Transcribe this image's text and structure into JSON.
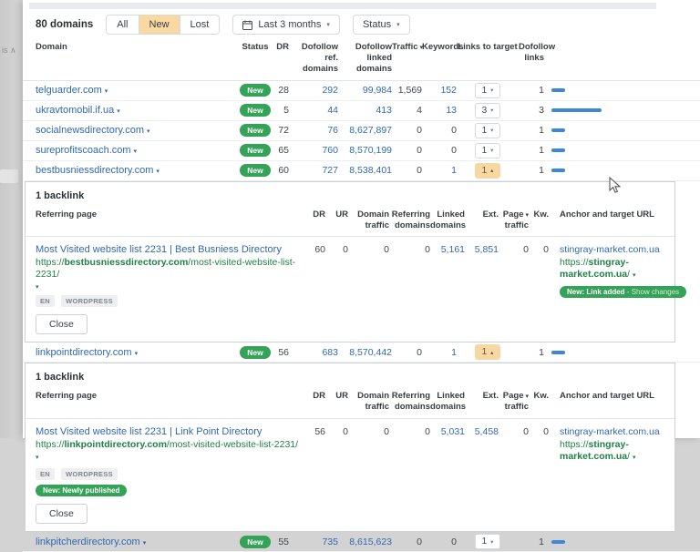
{
  "sidebar": {
    "fragment_label": "is ∧"
  },
  "toolbar": {
    "count_label": "80 domains",
    "filter_all": "All",
    "filter_new": "New",
    "filter_lost": "Lost",
    "date_range_label": "Last 3 months",
    "status_label": "Status"
  },
  "table": {
    "columns": {
      "domain": "Domain",
      "status": "Status",
      "dr": "DR",
      "dofollow_ref": [
        "Dofollow ref.",
        "domains"
      ],
      "dofollow_linked": [
        "Dofollow linked",
        "domains"
      ],
      "traffic": "Traffic",
      "keywords": "Keywords",
      "links_to_target": "Links to target",
      "dofollow_links": [
        "Dofollow",
        "links"
      ]
    },
    "rows": [
      {
        "domain": "telguarder.com",
        "status": "New",
        "dr": "28",
        "dofollow_ref": "292",
        "dofollow_linked": "99,984",
        "traffic": "1,569",
        "keywords": "152",
        "links_to_target": "1",
        "dofollow_links": "1"
      },
      {
        "domain": "ukravtomobil.if.ua",
        "status": "New",
        "dr": "5",
        "dofollow_ref": "44",
        "dofollow_linked": "413",
        "traffic": "4",
        "keywords": "13",
        "links_to_target": "3",
        "dofollow_links": "3"
      },
      {
        "domain": "socialnewsdirectory.com",
        "status": "New",
        "dr": "72",
        "dofollow_ref": "76",
        "dofollow_linked": "8,627,897",
        "traffic": "0",
        "keywords": "0",
        "links_to_target": "1",
        "dofollow_links": "1"
      },
      {
        "domain": "sureprofitscoach.com",
        "status": "New",
        "dr": "65",
        "dofollow_ref": "760",
        "dofollow_linked": "8,570,199",
        "traffic": "0",
        "keywords": "0",
        "links_to_target": "1",
        "dofollow_links": "1"
      },
      {
        "domain": "bestbusniessdirectory.com",
        "status": "New",
        "dr": "60",
        "dofollow_ref": "727",
        "dofollow_linked": "8,538,401",
        "traffic": "0",
        "keywords": "1",
        "links_to_target": "1",
        "dofollow_links": "1"
      },
      {
        "domain": "linkpointdirectory.com",
        "status": "New",
        "dr": "56",
        "dofollow_ref": "683",
        "dofollow_linked": "8,570,442",
        "traffic": "0",
        "keywords": "1",
        "links_to_target": "1",
        "dofollow_links": "1"
      },
      {
        "domain": "linkpitcherdirectory.com",
        "status": "New",
        "dr": "55",
        "dofollow_ref": "735",
        "dofollow_linked": "8,615,623",
        "traffic": "0",
        "keywords": "0",
        "links_to_target": "1",
        "dofollow_links": "1"
      }
    ]
  },
  "backlink_columns": {
    "referring_page": "Referring page",
    "dr": "DR",
    "ur": "UR",
    "domain_traffic": [
      "Domain",
      "traffic"
    ],
    "referring_domains": [
      "Referring",
      "domains"
    ],
    "linked_domains": [
      "Linked",
      "domains"
    ],
    "ext": "Ext.",
    "page_traffic": [
      "Page",
      "traffic"
    ],
    "kw": "Kw.",
    "anchor": "Anchor and target URL"
  },
  "panels": [
    {
      "title": "1 backlink",
      "row": {
        "title": "Most Visited website list 2231 | Best Busniess Directory",
        "url_prefix": "https://",
        "url_domain": "bestbusniessdirectory.com",
        "url_path": "/most-visited-website-list-2231/",
        "badges": [
          "EN",
          "WORDPRESS"
        ],
        "dr": "60",
        "ur": "0",
        "domain_traffic": "0",
        "referring_domains": "0",
        "linked_domains": "5,161",
        "ext": "5,851",
        "page_traffic": "0",
        "kw": "0",
        "anchor": "stingray-market.com.ua",
        "target_prefix": "https://",
        "target_domain": "stingray-market.com.ua",
        "target_path": "/",
        "change_badge": "New: Link added",
        "change_badge_suffix": "- Show changes"
      },
      "close_label": "Close"
    },
    {
      "title": "1 backlink",
      "row": {
        "title": "Most Visited website list 2231 | Link Point Directory",
        "url_prefix": "https://",
        "url_domain": "linkpointdirectory.com",
        "url_path": "/most-visited-website-list-2231/",
        "badges": [
          "EN",
          "WORDPRESS"
        ],
        "dr": "56",
        "ur": "0",
        "domain_traffic": "0",
        "referring_domains": "0",
        "linked_domains": "5,031",
        "ext": "5,458",
        "page_traffic": "0",
        "kw": "0",
        "anchor": "stingray-market.com.ua",
        "target_prefix": "https://",
        "target_domain": "stingray-market.com.ua",
        "target_path": "/",
        "change_badge": "New: Newly published"
      },
      "close_label": "Close"
    }
  ],
  "colors": {
    "link_blue": "#3069b0",
    "status_green": "#34a257",
    "url_green": "#1f8048",
    "active_filter_orange": "#f9d9a1",
    "bar_blue": "#3c86de"
  }
}
